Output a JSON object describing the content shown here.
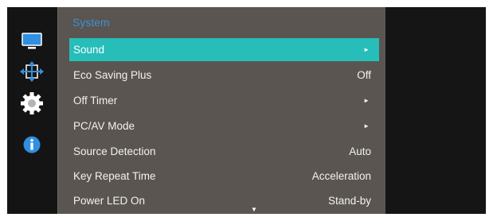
{
  "sidebar": {
    "icons": [
      "monitor-icon",
      "resize-arrows-icon",
      "gear-icon",
      "info-icon"
    ],
    "accent": "#2f8fe0"
  },
  "menu": {
    "section_title": "System",
    "items": [
      {
        "label": "Sound",
        "value": "",
        "has_submenu": true,
        "selected": true
      },
      {
        "label": "Eco Saving Plus",
        "value": "Off",
        "has_submenu": false,
        "selected": false
      },
      {
        "label": "Off Timer",
        "value": "",
        "has_submenu": true,
        "selected": false
      },
      {
        "label": "PC/AV Mode",
        "value": "",
        "has_submenu": true,
        "selected": false
      },
      {
        "label": "Source Detection",
        "value": "Auto",
        "has_submenu": false,
        "selected": false
      },
      {
        "label": "Key Repeat Time",
        "value": "Acceleration",
        "has_submenu": false,
        "selected": false
      },
      {
        "label": "Power LED On",
        "value": "Stand-by",
        "has_submenu": false,
        "selected": false
      }
    ],
    "submenu_arrow": "►",
    "more_indicator": "▼",
    "highlight_color": "#27bdb8"
  }
}
